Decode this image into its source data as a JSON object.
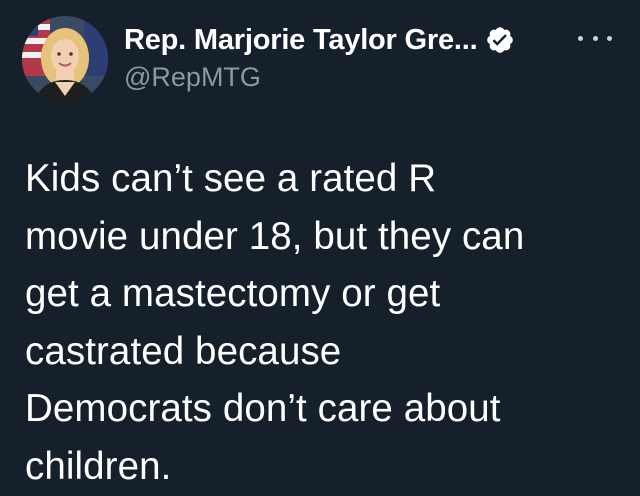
{
  "tweet": {
    "author": {
      "display_name": "Rep. Marjorie Taylor Gre...",
      "handle": "@RepMTG",
      "verified": true
    },
    "text_lines": [
      "Kids can’t see a rated R",
      "movie under 18, but they can",
      "get a mastectomy or get",
      "castrated because",
      "Democrats don’t care about",
      "children."
    ]
  },
  "icons": {
    "verified": "verified-badge-icon",
    "more": "more-options-icon"
  },
  "colors": {
    "background": "#15202b",
    "text_primary": "#ffffff",
    "text_secondary": "#8b98a5"
  }
}
